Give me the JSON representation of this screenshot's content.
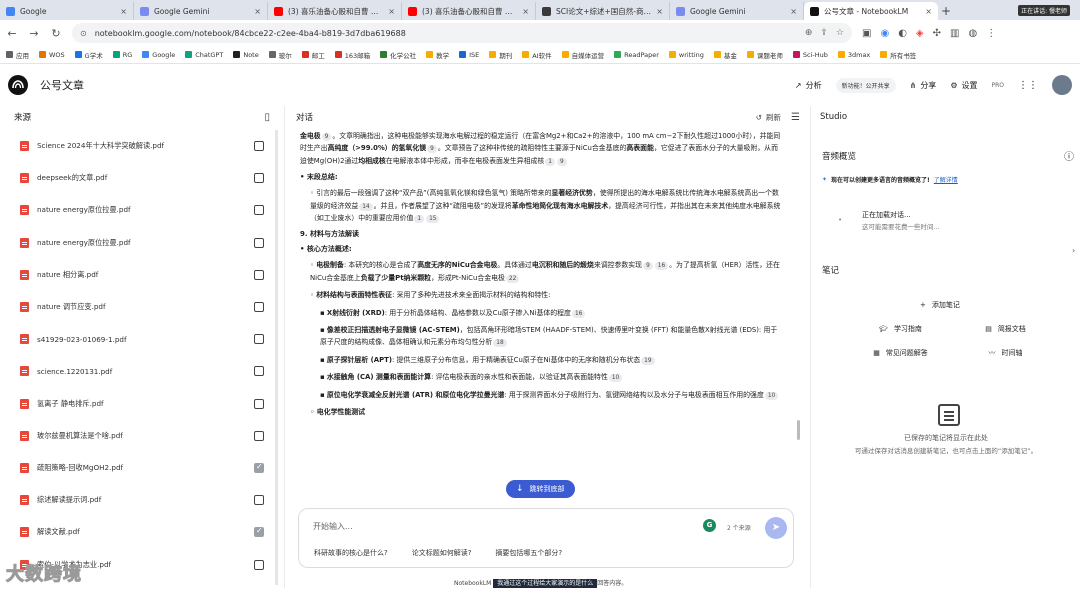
{
  "browser": {
    "tabs": [
      {
        "title": "Google",
        "color": "#4285f4"
      },
      {
        "title": "Google Gemini",
        "color": "#7a8cf0"
      },
      {
        "title": "(3) 喜乐油备心骰和自曹 ▌ 频...",
        "color": "#ff0000"
      },
      {
        "title": "(3) 喜乐油备心骰和自曹 ▌ 频...",
        "color": "#ff0000"
      },
      {
        "title": "SCI论文+综述+国自然-商业化...",
        "color": "#3a3a3a"
      },
      {
        "title": "Google Gemini",
        "color": "#7a8cf0"
      },
      {
        "title": "公号文章 - NotebookLM",
        "color": "#111111"
      }
    ],
    "window_badge": "正在讲话: 慢老师",
    "url": "notebooklm.google.com/notebook/84cbce22-c2ee-4ba4-b819-3d7dba619688",
    "bookmarks": [
      "应用",
      "WOS",
      "G学术",
      "RG",
      "Google",
      "ChatGPT",
      "Note",
      "玻尔",
      "邮工",
      "163邮箱",
      "化学公社",
      "教学",
      "ISE",
      "期刊",
      "AI软件",
      "自媒体运营",
      "ReadPaper",
      "writting",
      "基金",
      "课题老师",
      "Sci-Hub",
      "3dmax",
      "所有书签"
    ]
  },
  "header": {
    "notebook_title": "公号文章",
    "analyze_label": "分析",
    "new_pill": "新功能！公开共享",
    "share_label": "分享",
    "settings_label": "设置",
    "plan": "PRO"
  },
  "sources": {
    "title": "来源",
    "items": [
      {
        "name": "Science 2024年十大科学突破解读.pdf",
        "checked": false
      },
      {
        "name": "deepseek的文章.pdf",
        "checked": false
      },
      {
        "name": "nature energy原位拉曼.pdf",
        "checked": false
      },
      {
        "name": "nature energy原位拉曼.pdf",
        "checked": false
      },
      {
        "name": "nature 相分离.pdf",
        "checked": false
      },
      {
        "name": "nature 调节应变.pdf",
        "checked": false
      },
      {
        "name": "s41929-023-01069-1.pdf",
        "checked": false
      },
      {
        "name": "science.1220131.pdf",
        "checked": false
      },
      {
        "name": "氢离子 静电排斥.pdf",
        "checked": false
      },
      {
        "name": "玻尔兹曼机算法是个啥.pdf",
        "checked": false
      },
      {
        "name": "疏阻策略-回收MgOH2.pdf",
        "checked": true
      },
      {
        "name": "综述解读提示词.pdf",
        "checked": false
      },
      {
        "name": "解读文献.pdf",
        "checked": true
      },
      {
        "name": "索伯-以学术为志业.pdf",
        "checked": false
      }
    ]
  },
  "chat": {
    "title": "对话",
    "refresh_label": "刷新",
    "p1": {
      "a": "金电极",
      "c1": "9",
      "b": "。文章明确指出，这种电极能够实现海水电解过程的稳定运行（在富含Mg2+和Ca2+的溶液中，100 mA cm−2下耐久性超过1000小时），并能同时生产出",
      "c": "高纯度（>99.0%）的氢氧化镁",
      "c2": "9",
      "d": "。文章预告了这种非传统的疏阻特性主要源于NiCu合金基底的",
      "e": "高表面能",
      "f": "，它促进了表面水分子的大量吸附，从而迫使Mg(OH)2通过",
      "g": "均相成核",
      "h": "在电解液本体中形成，而非在电极表面发生异相成核",
      "c3": "1",
      "c4": "9"
    },
    "h_end": "• 末段总结:",
    "p2": {
      "a": "◦ 引言的最后一段强调了这种“双产品”(高纯氢氧化镁和绿色氢气) 策略所带来的",
      "b": "显著经济优势",
      "c": "，使得所提出的海水电解系统比传统海水电解系统高出一个数量级的经济效益",
      "c1": "14",
      "d": "。并且，作者展望了这种“疏阻电极”的发现将",
      "e": "革命性地简化现有海水电解技术",
      "f": "，提高经济可行性，并指出其在未来其他纯度水电解系统（如工业废水）中的重要应用价值",
      "c2": "1",
      "c3": "15"
    },
    "h9": "9. 材料与方法解读",
    "h_core": "• 核心方法概述:",
    "p3": {
      "a": "◦ ",
      "b": "电极制备",
      "c": ": 本研究的核心是合成了",
      "d": "高度无序的NiCu合金电极",
      "e": "。具体通过",
      "f": "电沉积和随后的煅烧",
      "g": "来调控参数实现",
      "c1": "9",
      "c2": "16",
      "h": "。为了提高析氢（HER）活性，还在NiCu合金基底上",
      "i": "负载了少量Pt纳米颗粒",
      "j": "，形成Pt-NiCu合金电极",
      "c3": "22"
    },
    "p4": {
      "a": "◦ ",
      "b": "材料结构与表面特性表征",
      "c": ": 采用了多种先进技术来全面揭示材料的结构和特性:"
    },
    "p5": {
      "a": "▪ ",
      "b": "X射线衍射 (XRD)",
      "c": ": 用于分析晶体结构、晶格参数以及Cu原子掺入Ni基体的程度",
      "c1": "16"
    },
    "p6": {
      "a": "▪ ",
      "b": "像差校正扫描透射电子显微镜 (AC-STEM)",
      "c": "，包括高角环形暗场STEM (HAADF-STEM)、快速傅里叶变换 (FFT) 和能量色散X射线光谱 (EDS): 用于原子尺度的结构成像、晶体相确认和元素分布均匀性分析",
      "c1": "18"
    },
    "p7": {
      "a": "▪ ",
      "b": "原子探针层析 (APT)",
      "c": ": 提供三维原子分布信息，用于精确表征Cu原子在Ni基体中的无序和随机分布状态",
      "c1": "19"
    },
    "p8": {
      "a": "▪ ",
      "b": "水接触角 (CA) 测量和表面能计算",
      "c": ": 评估电极表面的亲水性和表面能，以验证其高表面能特性",
      "c1": "10"
    },
    "p9": {
      "a": "▪ ",
      "b": "原位电化学衰减全反射光谱 (ATR) 和原位电化学拉曼光谱",
      "c": ": 用于探测界面水分子吸附行为、氢键网络结构以及水分子与电极表面相互作用的强度",
      "c1": "10"
    },
    "p10": "◦ 电化学性能测试",
    "jump_label": "跳转到底部",
    "input_placeholder": "开始输入...",
    "source_count": "2 个来源",
    "suggestions": [
      "科研故事的核心是什么?",
      "论文标题如何解读?",
      "摘要包括哪五个部分?"
    ],
    "footer_a": "NotebookLM",
    "footer_hl": "我通过这个过程给大家演示的是什么",
    "footer_b": "回答内容。"
  },
  "studio": {
    "title": "Studio",
    "audio_title": "音频概览",
    "audio_banner": "现在可以创建更多语言的音频概览了!",
    "audio_link": "了解详情",
    "loading_title": "正在加载对话...",
    "loading_sub": "这可能需要花费一些时间...",
    "notes_title": "笔记",
    "add_note": "添加笔记",
    "note_actions": [
      "学习指南",
      "简报文档",
      "常见问题解答",
      "时间轴"
    ],
    "empty_title": "已保存的笔记将显示在此处",
    "empty_sub": "可通过保存对话消息创建新笔记，也可点击上面的“添加笔记”。"
  },
  "watermark": "大数跨境"
}
